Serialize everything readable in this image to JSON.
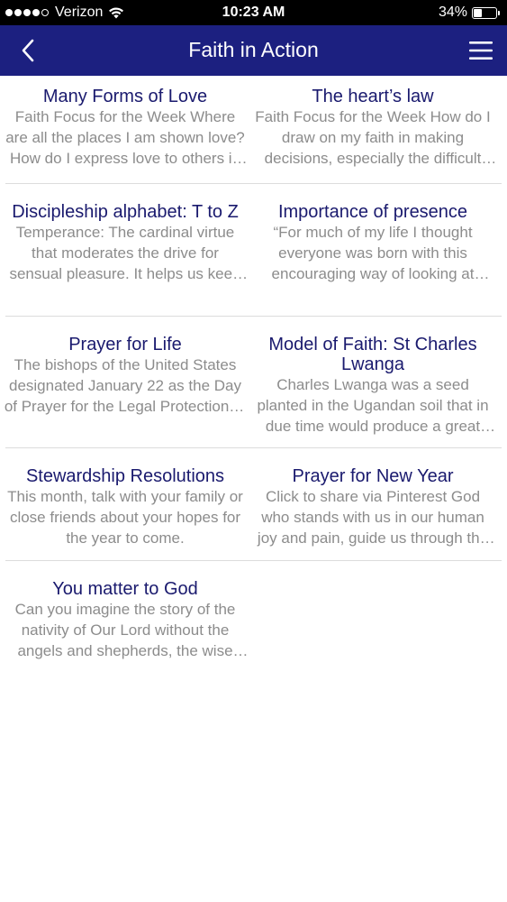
{
  "status_bar": {
    "carrier": "Verizon",
    "time": "10:23 AM",
    "battery": "34%",
    "battery_level": 0.34,
    "signal_bars": 4
  },
  "nav": {
    "title": "Faith in Action",
    "back_icon": "chevron-left-icon",
    "menu_icon": "hamburger-menu-icon"
  },
  "articles": [
    {
      "title": "Many Forms of Love",
      "description": "Faith Focus for the Week Where are all the places I am shown love? How do I express love to others in my daily life?"
    },
    {
      "title": "The heart’s law",
      "description": "Faith Focus for the Week How do I draw on my faith in making decisions, especially the difficult ones?"
    },
    {
      "title": "Discipleship alphabet: T to Z",
      "description": "Temperance: The cardinal virtue that moderates the drive for sensual pleasure. It helps us keep balance."
    },
    {
      "title": "Importance of presence",
      "description": "“For much of my life I thought everyone was born with this encouraging way of looking at things."
    },
    {
      "title": "Prayer for Life",
      "description": "The bishops of the United States designated January 22 as the Day of Prayer for the Legal Protection of Unborn Children."
    },
    {
      "title": "Model of Faith: St Charles Lwanga",
      "description": "Charles Lwanga was a seed planted in the Ugandan soil that in due time would produce a great harvest."
    },
    {
      "title": "Stewardship Resolutions",
      "description": "This month, talk with your family or close friends about your hopes for the year to come."
    },
    {
      "title": "Prayer for New Year",
      "description": "Click to share via Pinterest God who stands with us in our human joy and pain, guide us through the year."
    },
    {
      "title": "You matter to God",
      "description": "Can you imagine the story of the nativity of Our Lord without the angels and shepherds, the wise men and the star?"
    }
  ],
  "colors": {
    "nav_background": "#1c2080",
    "title_text": "#1a1a6e",
    "description_text": "#8c8c8c",
    "divider": "#dcdcdc"
  }
}
